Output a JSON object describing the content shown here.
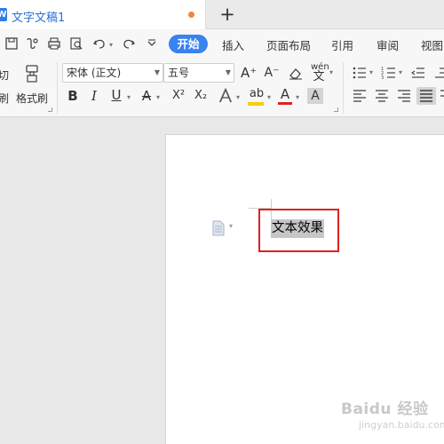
{
  "tab": {
    "logo": "W",
    "title": "文字文稿1",
    "new_tab": "+"
  },
  "menu": {
    "active": "开始",
    "items": [
      "插入",
      "页面布局",
      "引用",
      "审阅",
      "视图"
    ]
  },
  "ribbon": {
    "cut_label": "切",
    "paste_label": "刷",
    "format_painter": "格式刷",
    "font_name": "宋体 (正文)",
    "font_size": "五号",
    "bold": "B",
    "italic": "I",
    "underline": "U",
    "superscript": "X²",
    "subscript": "X₂",
    "grow_font": "A⁺",
    "shrink_font": "A⁻",
    "pinyin": "wén",
    "font_color_letter": "A",
    "shading_letter": "A",
    "highlight_letter": "ab"
  },
  "document": {
    "selected_text": "文本效果"
  },
  "watermark": {
    "brand": "Baidu 经验",
    "url": "jingyan.baidu.com"
  },
  "colors": {
    "accent": "#3a82ee",
    "tab_title": "#2d6fd6",
    "unsaved_dot": "#f0863a",
    "annotation_box": "#e02020",
    "highlight_yellow": "#f5d000",
    "font_color_red": "#e02020"
  }
}
